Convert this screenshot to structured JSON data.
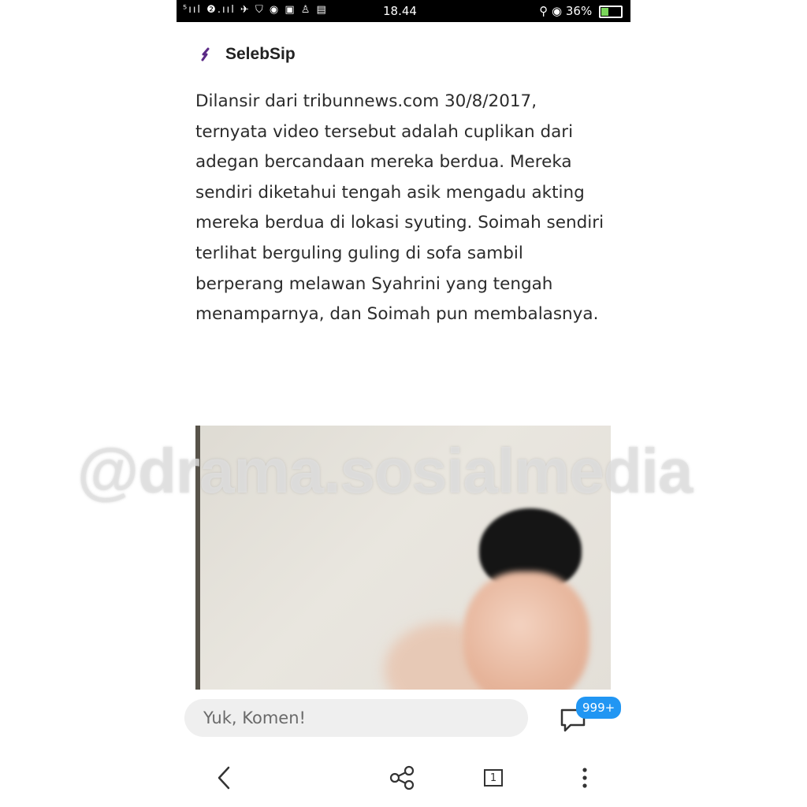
{
  "status_bar": {
    "left_icons": "⁵ııl ❷.ııl ✈ ⛉ ◉ ▣ ♙ ▤",
    "time": "18.44",
    "right_icons": "⚲ ◉",
    "battery": "36%"
  },
  "header": {
    "logo_icon": "selebsip-logo-icon",
    "brand": "SelebSip"
  },
  "article": {
    "paragraph": "Dilansir dari tribunnews.com 30/8/2017, ternyata video tersebut adalah cuplikan dari adegan bercandaan mereka berdua. Mereka sendiri diketahui tengah asik mengadu akting mereka berdua di lokasi syuting. Soimah sendiri terlihat berguling guling di sofa sambil berperang melawan Syahrini yang tengah menamparnya, dan Soimah pun membalasnya."
  },
  "watermark": "@drama.sosialmedia",
  "comment": {
    "placeholder": "Yuk, Komen!",
    "badge": "999+"
  },
  "nav": {
    "tab_count": "1"
  },
  "colors": {
    "badge": "#2196f3",
    "brand_logo": "#5b2a86"
  }
}
